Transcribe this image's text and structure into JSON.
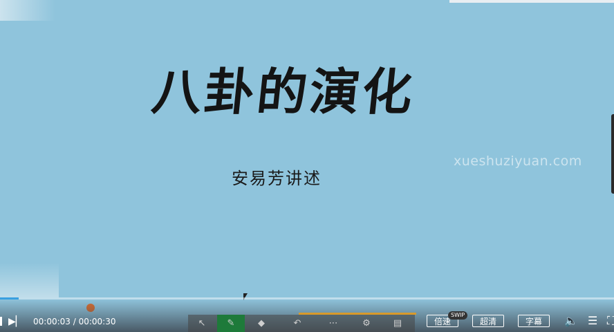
{
  "slide": {
    "title": "八卦的演化",
    "subtitle": "安易芳讲述",
    "watermark": "xueshuziyuan.com"
  },
  "player": {
    "current_time": "00:00:03",
    "separator": " / ",
    "duration": "00:00:30",
    "progress": 0.03,
    "speed_label": "倍速",
    "speed_badge": "SWIP",
    "quality_label": "超清",
    "subtitle_label": "字幕",
    "icons": {
      "play": "play-icon",
      "volume": "volume-icon",
      "playlist": "playlist-icon",
      "fullscreen": "fullscreen-icon"
    }
  },
  "ppt_toolbar": {
    "icons": [
      "pointer-icon",
      "pen-icon",
      "eraser-icon",
      "undo-icon",
      "more-icon",
      "settings-icon",
      "chat-icon"
    ]
  },
  "colors": {
    "background": "#8fc4dc",
    "progress": "#3aa0e0",
    "pen_active": "#1e7a3a"
  }
}
